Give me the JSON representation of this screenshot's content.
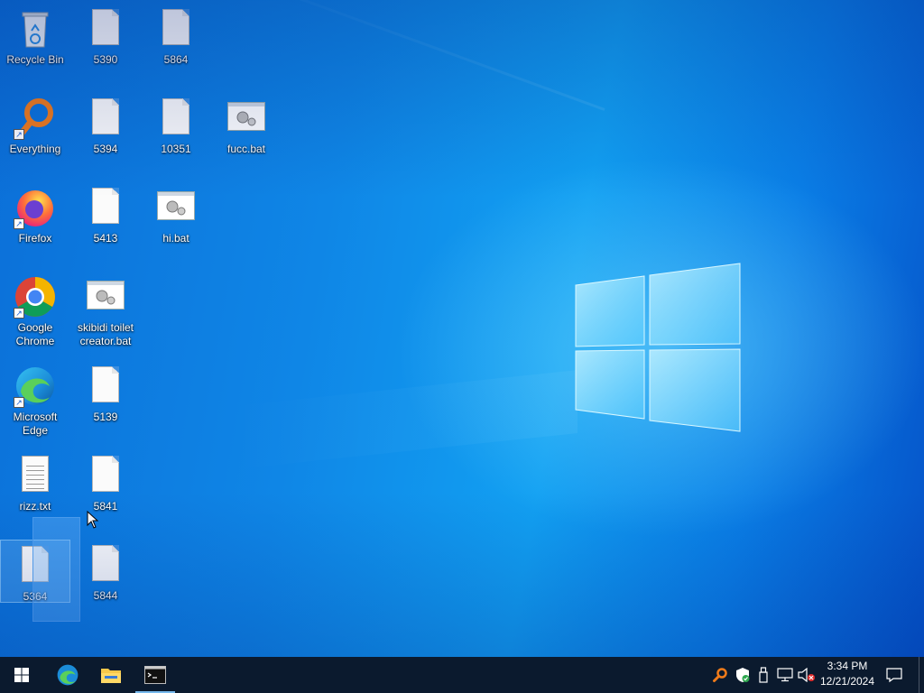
{
  "desktop": {
    "icons": [
      {
        "label": "Recycle Bin",
        "icon": "recycle-bin-icon"
      },
      {
        "label": "5390",
        "icon": "blank-file-icon"
      },
      {
        "label": "5864",
        "icon": "blank-file-icon"
      },
      {
        "label": "Everything",
        "icon": "everything-search-icon"
      },
      {
        "label": "5394",
        "icon": "blank-file-icon"
      },
      {
        "label": "10351",
        "icon": "blank-file-icon"
      },
      {
        "label": "fucc.bat",
        "icon": "batch-file-icon"
      },
      {
        "label": "Firefox",
        "icon": "firefox-icon"
      },
      {
        "label": "5413",
        "icon": "blank-file-icon"
      },
      {
        "label": "hi.bat",
        "icon": "batch-file-icon"
      },
      {
        "label": "Google Chrome",
        "icon": "chrome-icon"
      },
      {
        "label": "skibidi toilet creator.bat",
        "icon": "batch-file-icon"
      },
      {
        "label": "Microsoft Edge",
        "icon": "edge-icon"
      },
      {
        "label": "5139",
        "icon": "blank-file-icon"
      },
      {
        "label": "rizz.txt",
        "icon": "text-file-icon"
      },
      {
        "label": "5841",
        "icon": "blank-file-icon"
      },
      {
        "label": "5364",
        "icon": "blank-file-icon"
      },
      {
        "label": "5844",
        "icon": "blank-file-icon"
      }
    ]
  },
  "taskbar": {
    "buttons": [
      {
        "name": "start",
        "icon": "windows-start-icon"
      },
      {
        "name": "edge",
        "icon": "edge-icon"
      },
      {
        "name": "file-explorer",
        "icon": "folder-icon"
      },
      {
        "name": "command-prompt",
        "icon": "terminal-icon"
      }
    ],
    "tray": {
      "icons": [
        "everything-tray-icon",
        "security-shield-icon",
        "usb-icon",
        "network-icon",
        "volume-muted-icon"
      ],
      "time": "3:34 PM",
      "date": "12/21/2024"
    }
  },
  "colors": {
    "taskbar": "#0b1a2e",
    "desktop_blue": "#0f86e6",
    "accent": "#76b9ed"
  }
}
